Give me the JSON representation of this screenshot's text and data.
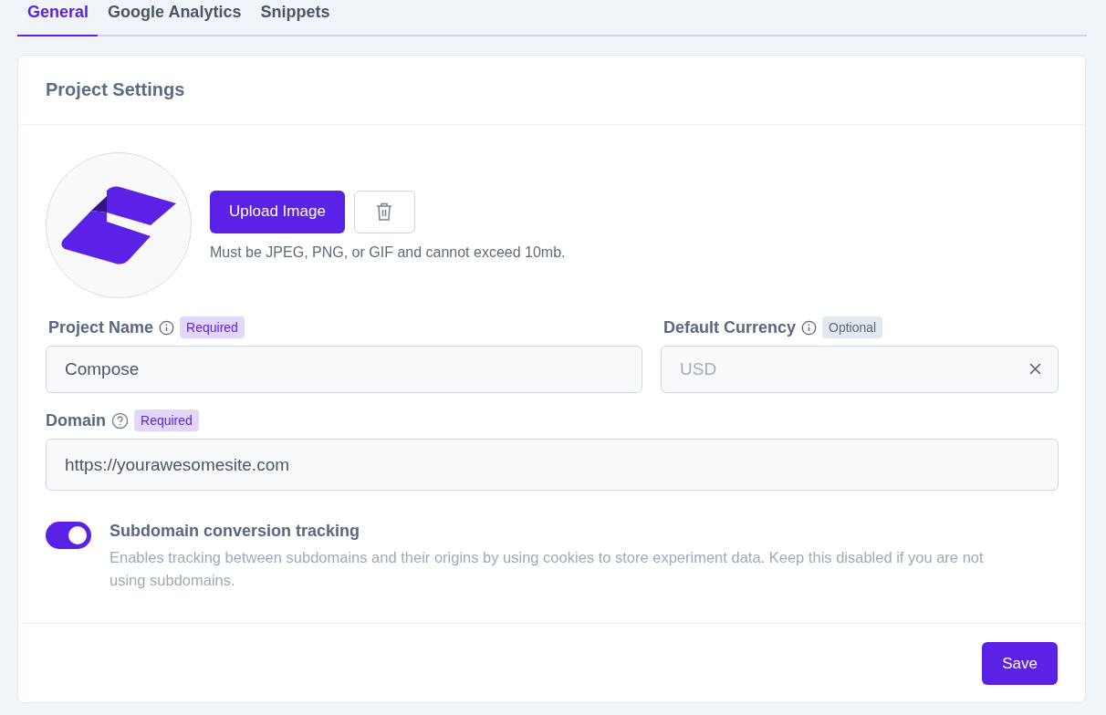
{
  "tabs": [
    {
      "label": "General",
      "selected": true
    },
    {
      "label": "Google Analytics",
      "selected": false
    },
    {
      "label": "Snippets",
      "selected": false
    }
  ],
  "card": {
    "title": "Project Settings",
    "upload": {
      "button": "Upload Image",
      "note": "Must be JPEG, PNG, or GIF and cannot exceed 10mb."
    },
    "fields": [
      {
        "label": "Project Name",
        "help": false,
        "badge": {
          "text": "Required",
          "kind": "required"
        },
        "kind": "text",
        "value": "Compose"
      },
      {
        "label": "Default Currency",
        "help": false,
        "badge": {
          "text": "Optional",
          "kind": "optional"
        },
        "kind": "select",
        "placeholder": "USD"
      },
      {
        "label": "Domain",
        "help": true,
        "badge": {
          "text": "Required",
          "kind": "required"
        },
        "kind": "text",
        "value": "https://yourawesomesite.com"
      }
    ],
    "toggle": {
      "title": "Subdomain conversion tracking",
      "description": "Enables tracking between subdomains and their origins by using cookies to store experiment data. Keep this disabled if you are not using subdomains.",
      "on": true
    },
    "save": "Save"
  }
}
